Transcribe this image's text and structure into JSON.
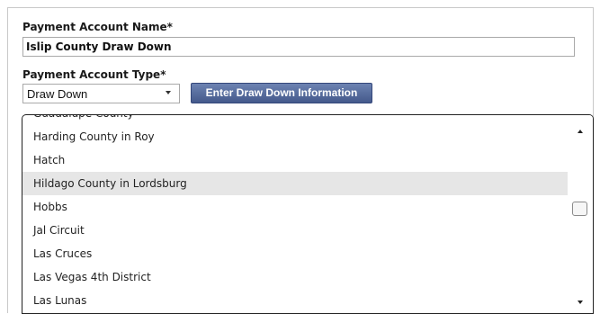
{
  "form": {
    "name_label": "Payment Account Name*",
    "name_value": "Islip County Draw Down",
    "type_label": "Payment Account Type*",
    "type_selected": "Draw Down",
    "draw_down_button": "Enter Draw Down Information"
  },
  "list": {
    "items": [
      "Guadalupe County",
      "Harding County in Roy",
      "Hatch",
      "Hildago County in Lordsburg",
      "Hobbs",
      "Jal Circuit",
      "Las Cruces",
      "Las Vegas 4th District",
      "Las Lunas"
    ],
    "selected_index": 3
  }
}
